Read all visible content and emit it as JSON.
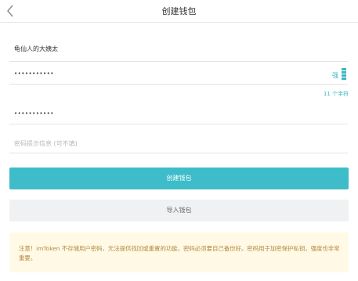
{
  "header": {
    "title": "创建钱包"
  },
  "form": {
    "wallet_name_value": "龟仙人的大姨太",
    "password_value": "•••••••••••",
    "password_strength_label": "强",
    "password_char_count": "11 个字符",
    "repeat_password_value": "•••••••••••",
    "hint_placeholder": "密码提示信息 (可不填)"
  },
  "buttons": {
    "create_label": "创建钱包",
    "import_label": "导入钱包"
  },
  "notice": {
    "text": "注意！imToken 不存储用户密码，无法提供找回或重置的功能，密码必须要自己备份好。密码用于加密保护私钥，强度也非常重要。"
  },
  "colors": {
    "accent": "#3ebcc9",
    "notice_bg": "#fff9e6",
    "notice_text": "#b58b3c"
  },
  "icons": {
    "back": "chevron-left-icon",
    "strength": "strength-bars-icon"
  }
}
